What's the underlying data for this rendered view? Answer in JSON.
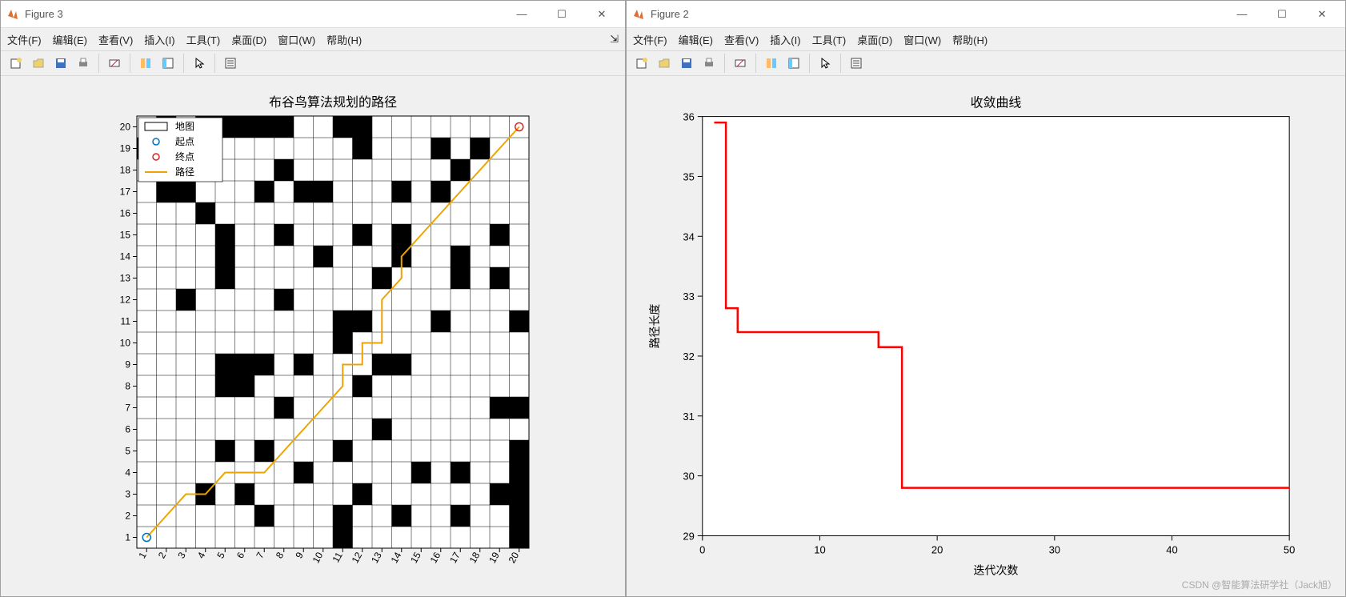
{
  "figure_left": {
    "title": "Figure 3",
    "menus": [
      "文件(F)",
      "编辑(E)",
      "查看(V)",
      "插入(I)",
      "工具(T)",
      "桌面(D)",
      "窗口(W)",
      "帮助(H)"
    ],
    "chart_title": "布谷鸟算法规划的路径",
    "legend": {
      "map": "地图",
      "start": "起点",
      "end": "终点",
      "path": "路径"
    },
    "xlabel": "",
    "ylabel": "",
    "x_ticks": [
      1,
      2,
      3,
      4,
      5,
      6,
      7,
      8,
      9,
      10,
      11,
      12,
      13,
      14,
      15,
      16,
      17,
      18,
      19,
      20
    ],
    "y_ticks": [
      1,
      2,
      3,
      4,
      5,
      6,
      7,
      8,
      9,
      10,
      11,
      12,
      13,
      14,
      15,
      16,
      17,
      18,
      19,
      20
    ]
  },
  "figure_right": {
    "title": "Figure 2",
    "menus": [
      "文件(F)",
      "编辑(E)",
      "查看(V)",
      "插入(I)",
      "工具(T)",
      "桌面(D)",
      "窗口(W)",
      "帮助(H)"
    ],
    "chart_title": "收敛曲线",
    "xlabel": "迭代次数",
    "ylabel": "路径长度"
  },
  "watermark": "CSDN @智能算法研学社（Jack旭）",
  "chart_data": [
    {
      "type": "heatmap",
      "title": "布谷鸟算法规划的路径",
      "grid_size": 20,
      "xlim": [
        1,
        20
      ],
      "ylim": [
        1,
        20
      ],
      "x_ticks": [
        1,
        2,
        3,
        4,
        5,
        6,
        7,
        8,
        9,
        10,
        11,
        12,
        13,
        14,
        15,
        16,
        17,
        18,
        19,
        20
      ],
      "y_ticks": [
        1,
        2,
        3,
        4,
        5,
        6,
        7,
        8,
        9,
        10,
        11,
        12,
        13,
        14,
        15,
        16,
        17,
        18,
        19,
        20
      ],
      "obstacles": [
        [
          1,
          19
        ],
        [
          2,
          17
        ],
        [
          2,
          19
        ],
        [
          2,
          20
        ],
        [
          3,
          12
        ],
        [
          3,
          17
        ],
        [
          3,
          19
        ],
        [
          4,
          3
        ],
        [
          4,
          16
        ],
        [
          4,
          20
        ],
        [
          5,
          5
        ],
        [
          5,
          8
        ],
        [
          5,
          9
        ],
        [
          5,
          13
        ],
        [
          5,
          14
        ],
        [
          5,
          15
        ],
        [
          5,
          20
        ],
        [
          6,
          3
        ],
        [
          6,
          8
        ],
        [
          6,
          9
        ],
        [
          6,
          20
        ],
        [
          7,
          2
        ],
        [
          7,
          5
        ],
        [
          7,
          9
        ],
        [
          7,
          17
        ],
        [
          7,
          20
        ],
        [
          8,
          7
        ],
        [
          8,
          12
        ],
        [
          8,
          15
        ],
        [
          8,
          18
        ],
        [
          8,
          20
        ],
        [
          9,
          4
        ],
        [
          9,
          9
        ],
        [
          9,
          17
        ],
        [
          10,
          14
        ],
        [
          10,
          17
        ],
        [
          11,
          1
        ],
        [
          11,
          2
        ],
        [
          11,
          5
        ],
        [
          11,
          10
        ],
        [
          11,
          11
        ],
        [
          11,
          20
        ],
        [
          12,
          3
        ],
        [
          12,
          8
        ],
        [
          12,
          11
        ],
        [
          12,
          15
        ],
        [
          12,
          19
        ],
        [
          12,
          20
        ],
        [
          13,
          6
        ],
        [
          13,
          9
        ],
        [
          13,
          13
        ],
        [
          14,
          2
        ],
        [
          14,
          9
        ],
        [
          14,
          14
        ],
        [
          14,
          15
        ],
        [
          14,
          17
        ],
        [
          15,
          4
        ],
        [
          16,
          11
        ],
        [
          16,
          17
        ],
        [
          16,
          19
        ],
        [
          17,
          2
        ],
        [
          17,
          4
        ],
        [
          17,
          13
        ],
        [
          17,
          14
        ],
        [
          17,
          18
        ],
        [
          18,
          19
        ],
        [
          19,
          3
        ],
        [
          19,
          7
        ],
        [
          19,
          13
        ],
        [
          19,
          15
        ],
        [
          20,
          1
        ],
        [
          20,
          2
        ],
        [
          20,
          3
        ],
        [
          20,
          4
        ],
        [
          20,
          5
        ],
        [
          20,
          7
        ],
        [
          20,
          11
        ]
      ],
      "start": [
        1,
        1
      ],
      "end": [
        20,
        20
      ],
      "path": [
        [
          1,
          1
        ],
        [
          2,
          2
        ],
        [
          3,
          3
        ],
        [
          4,
          3
        ],
        [
          5,
          4
        ],
        [
          6,
          4
        ],
        [
          7,
          4
        ],
        [
          8,
          5
        ],
        [
          9,
          6
        ],
        [
          10,
          7
        ],
        [
          11,
          8
        ],
        [
          11,
          9
        ],
        [
          12,
          9
        ],
        [
          12,
          10
        ],
        [
          13,
          10
        ],
        [
          13,
          11
        ],
        [
          13,
          12
        ],
        [
          14,
          13
        ],
        [
          14,
          14
        ],
        [
          15,
          15
        ],
        [
          16,
          16
        ],
        [
          17,
          17
        ],
        [
          18,
          18
        ],
        [
          19,
          19
        ],
        [
          20,
          20
        ]
      ],
      "legend_entries": [
        {
          "name": "地图",
          "symbol": "rect",
          "color": "#000"
        },
        {
          "name": "起点",
          "symbol": "circle",
          "color": "#0072bd"
        },
        {
          "name": "终点",
          "symbol": "circle",
          "color": "#d62728"
        },
        {
          "name": "路径",
          "symbol": "line",
          "color": "#eda400"
        }
      ]
    },
    {
      "type": "line",
      "title": "收敛曲线",
      "xlabel": "迭代次数",
      "ylabel": "路径长度",
      "xlim": [
        0,
        50
      ],
      "ylim": [
        29,
        36
      ],
      "x_ticks": [
        0,
        10,
        20,
        30,
        40,
        50
      ],
      "y_ticks": [
        29,
        30,
        31,
        32,
        33,
        34,
        35,
        36
      ],
      "series": [
        {
          "name": "convergence",
          "color": "#ff0000",
          "x": [
            1,
            2,
            3,
            4,
            5,
            10,
            15,
            16,
            17,
            50
          ],
          "y": [
            35.9,
            32.8,
            32.4,
            32.4,
            32.4,
            32.4,
            32.15,
            32.15,
            29.8,
            29.8
          ]
        }
      ]
    }
  ]
}
